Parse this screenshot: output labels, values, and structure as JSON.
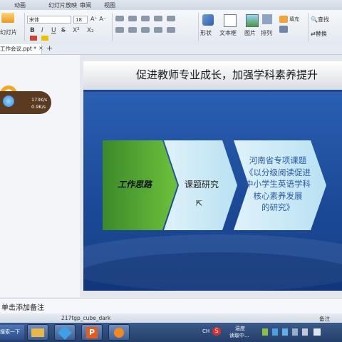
{
  "menu": {
    "animation": "动画",
    "slideshow": "幻灯片放映",
    "review": "审阅",
    "view": "视图"
  },
  "ribbon": {
    "slide_label": "幻灯片",
    "font_name": "宋体",
    "font_size": "18",
    "bold": "B",
    "italic": "I",
    "underline": "U",
    "strike": "S",
    "superscript": "X²",
    "subscript": "X₂",
    "shape": "形状",
    "textbox": "文本框",
    "picture": "图片",
    "arrange": "排列",
    "find": "查找",
    "replace": "替换",
    "fill": "填充"
  },
  "tab": {
    "doc_name": "工作会议.ppt *",
    "new_tab": "+"
  },
  "network": {
    "up": "173K/s",
    "down": "0.9K/s"
  },
  "slide": {
    "title": "促进教师专业成长，加强学科素养提升",
    "box1": "工作思路",
    "box2": "课题研究",
    "box3_lines": [
      "河南省专项课题",
      "《以分级阅读促进",
      "中小学生英语学科",
      "核心素养发展",
      "的研究》"
    ]
  },
  "notes": {
    "placeholder": "单击添加备注"
  },
  "status": {
    "theme": "217tgp_cube_dark",
    "notes_btn": "备注"
  },
  "taskbar": {
    "start": "搜索一下",
    "tray_text1": "温度",
    "tray_text2": "读取中..."
  }
}
